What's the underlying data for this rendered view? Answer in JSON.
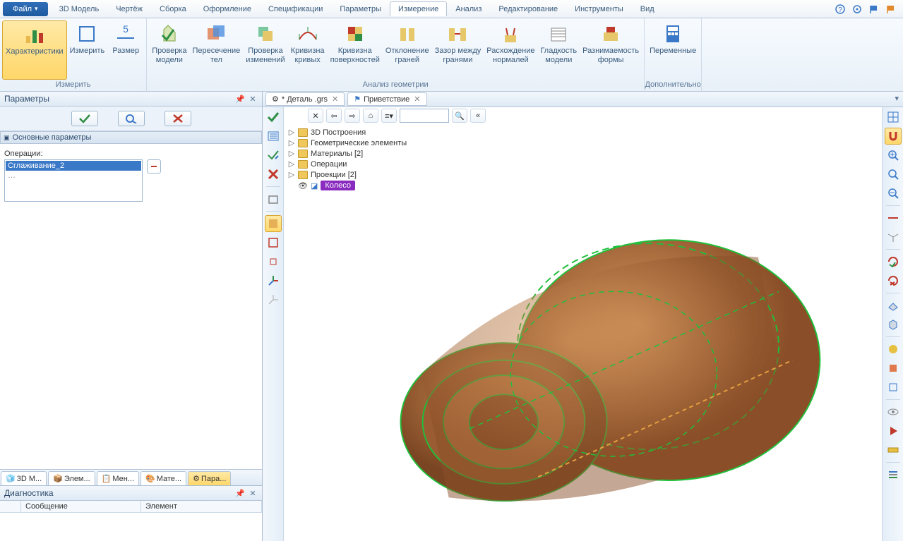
{
  "menu": {
    "file": "Файл",
    "items": [
      "3D Модель",
      "Чертёж",
      "Сборка",
      "Оформление",
      "Спецификации",
      "Параметры",
      "Измерение",
      "Анализ",
      "Редактирование",
      "Инструменты",
      "Вид"
    ],
    "active_index": 6
  },
  "ribbon": {
    "groups": [
      {
        "label": "Измерить",
        "buttons": [
          {
            "label": "Характеристики",
            "active": true
          },
          {
            "label": "Измерить"
          },
          {
            "label": "Размер"
          }
        ]
      },
      {
        "label": "Анализ геометрии",
        "buttons": [
          {
            "label": "Проверка\nмодели"
          },
          {
            "label": "Пересечение\nтел"
          },
          {
            "label": "Проверка\nизменений"
          },
          {
            "label": "Кривизна\nкривых"
          },
          {
            "label": "Кривизна\nповерхностей"
          },
          {
            "label": "Отклонение\nграней"
          },
          {
            "label": "Зазор между\nгранями"
          },
          {
            "label": "Расхождение\nнормалей"
          },
          {
            "label": "Гладкость\nмодели"
          },
          {
            "label": "Разнимаемость\nформы"
          }
        ]
      },
      {
        "label": "Дополнительно",
        "buttons": [
          {
            "label": "Переменные"
          }
        ]
      }
    ]
  },
  "params_panel": {
    "title": "Параметры",
    "section": "Основные параметры",
    "operations_label": "Операции:",
    "operations": [
      "Сглаживание_2"
    ],
    "ellipsis": "…"
  },
  "bottom_tabs": [
    "3D М...",
    "Элем...",
    "Мен...",
    "Мате...",
    "Пара..."
  ],
  "bottom_tabs_active": 4,
  "diagnostics": {
    "title": "Диагностика",
    "col_message": "Сообщение",
    "col_element": "Элемент"
  },
  "doc_tabs": [
    {
      "label": "* Деталь .grs"
    },
    {
      "label": "Приветствие"
    }
  ],
  "tree": {
    "items": [
      "3D Построения",
      "Геометрические элементы",
      "Материалы [2]",
      "Операции",
      "Проекции [2]"
    ],
    "badge": "Колесо"
  }
}
